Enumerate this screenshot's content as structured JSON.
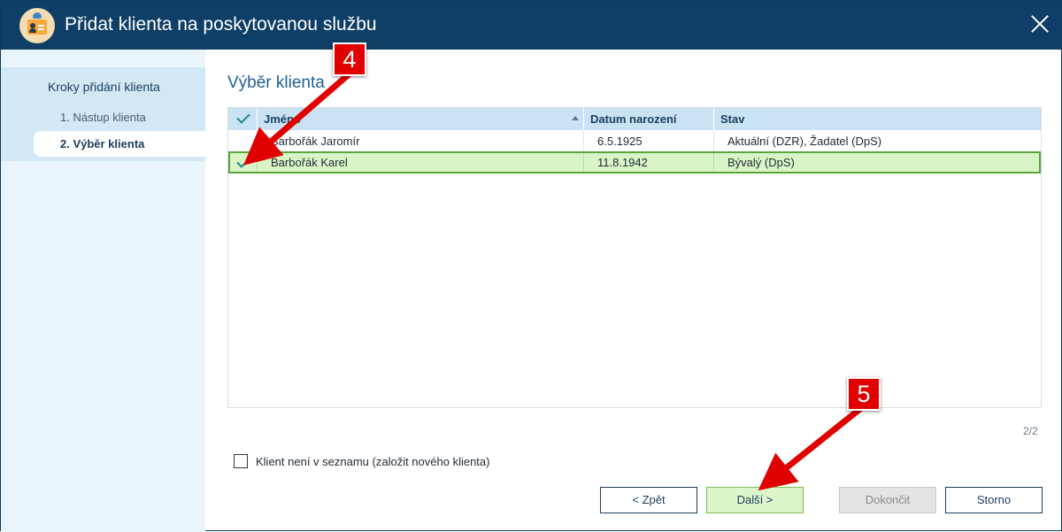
{
  "window": {
    "title": "Přidat klienta na poskytovanou službu",
    "icon": "client-card-icon"
  },
  "sidebar": {
    "heading": "Kroky přidání klienta",
    "steps": [
      {
        "label": "1. Nástup klienta",
        "active": false
      },
      {
        "label": "2. Výběr klienta",
        "active": true
      }
    ]
  },
  "main": {
    "section_title": "Výběr klienta",
    "table": {
      "columns": [
        "",
        "Jméno",
        "Datum narození",
        "Stav"
      ],
      "sorted_column": "Jméno",
      "rows": [
        {
          "checked": false,
          "name": "Barbořák Jaromír",
          "birth_date": "6.5.1925",
          "status": "Aktuální (DZR), Žadatel (DpS)"
        },
        {
          "checked": true,
          "name": "Barbořák Karel",
          "birth_date": "11.8.1942",
          "status": "Bývalý (DpS)"
        }
      ]
    },
    "pager": "2/2",
    "checkbox_label": "Klient není v seznamu (založit nového klienta)",
    "checkbox_checked": false
  },
  "buttons": {
    "back": "< Zpět",
    "next": "Další >",
    "finish": "Dokončit",
    "cancel": "Storno"
  },
  "annotations": {
    "badge_4": "4",
    "badge_5": "5"
  },
  "colors": {
    "titlebar": "#0f3f66",
    "accent": "#1f5f94",
    "selected_row": "#d9f5c7",
    "selected_border": "#5ba33c",
    "annotation": "#e00000"
  }
}
